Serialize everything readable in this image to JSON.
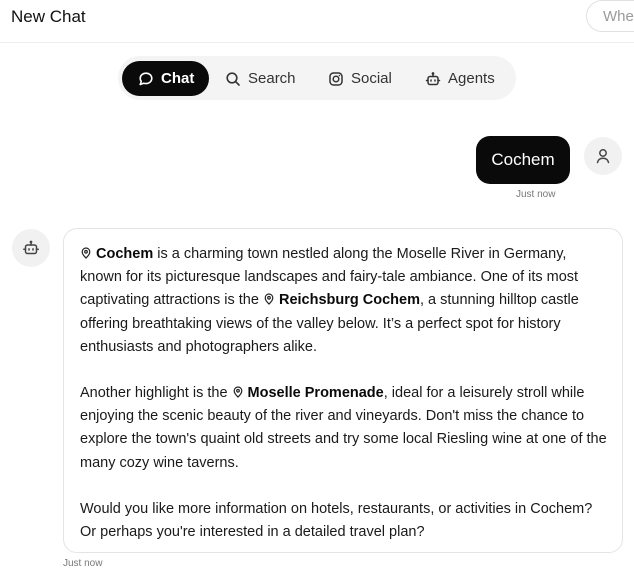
{
  "header": {
    "title": "New Chat",
    "search_placeholder": "Whe"
  },
  "tabs": [
    {
      "label": "Chat",
      "icon": "chat-bubble-icon",
      "active": true
    },
    {
      "label": "Search",
      "icon": "search-icon",
      "active": false
    },
    {
      "label": "Social",
      "icon": "instagram-icon",
      "active": false
    },
    {
      "label": "Agents",
      "icon": "robot-icon",
      "active": false
    }
  ],
  "messages": {
    "user": {
      "text": "Cochem",
      "time": "Just now"
    },
    "bot": {
      "time": "Just now",
      "p1": {
        "place1": "Cochem",
        "text1": " is a charming town nestled along the Moselle River in Germany, known for its picturesque landscapes and fairy-tale ambiance. One of its most captivating attractions is the ",
        "place2": "Reichsburg Cochem",
        "text2": ", a stunning hilltop castle offering breathtaking views of the valley below. It’s a perfect spot for history enthusiasts and photographers alike."
      },
      "p2": {
        "text1": "Another highlight is the ",
        "place1": "Moselle Promenade",
        "text2": ", ideal for a leisurely stroll while enjoying the scenic beauty of the river and vineyards. Don't miss the chance to explore the town's quaint old streets and try some local Riesling wine at one of the many cozy wine taverns."
      },
      "p3": "Would you like more information on hotels, restaurants, or activities in Cochem? Or perhaps you're interested in a detailed travel plan?"
    }
  },
  "colors": {
    "accent": "#0a0a0a",
    "tab_bg": "#f4f4f5",
    "border": "#e4e4e7"
  }
}
